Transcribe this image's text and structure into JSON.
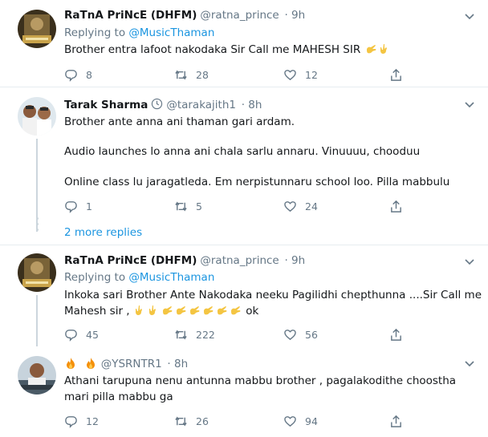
{
  "tweets": [
    {
      "name": "RaTnA PriNcE (DHFM)",
      "handle": "@ratna_prince",
      "time": "· 9h",
      "replying_prefix": "Replying to",
      "replying_to": "@MusicThaman",
      "lines": [
        "Brother entra lafoot nakodaka Sir Call me MAHESH SIR"
      ],
      "replies": "8",
      "retweets": "28",
      "likes": "12"
    },
    {
      "name": "Tarak Sharma",
      "handle": "@tarakajith1",
      "time": "· 8h",
      "lines": [
        "Brother ante anna ani thaman gari ardam.",
        "Audio launches lo anna ani chala sarlu annaru. Vinuuuu, chooduu",
        "Online class lu jaragatleda. Em nerpistunnaru school loo. Pilla mabbulu"
      ],
      "replies": "1",
      "retweets": "5",
      "likes": "24"
    },
    {
      "name": "RaTnA PriNcE (DHFM)",
      "handle": "@ratna_prince",
      "time": "· 9h",
      "replying_prefix": "Replying to",
      "replying_to": "@MusicThaman",
      "lines": [
        "Inkoka sari Brother Ante Nakodaka neeku Pagilidhi chepthunna ....Sir Call me",
        "Mahesh sir ,",
        "ok"
      ],
      "replies": "45",
      "retweets": "222",
      "likes": "56"
    },
    {
      "name": "",
      "handle": "@YSRNTR1",
      "time": "· 8h",
      "lines": [
        "Athani tarupuna nenu antunna  mabbu brother , pagalakodithe choostha",
        "mari pilla mabbu ga"
      ],
      "replies": "12",
      "retweets": "26",
      "likes": "94"
    }
  ],
  "more_replies": "2 more replies",
  "icons": [
    "reply-icon",
    "retweet-icon",
    "like-icon",
    "share-icon",
    "chevron-down-icon",
    "verified-icon",
    "raised-hand-emoji",
    "fire-emoji"
  ],
  "colors": {
    "link": "#1b95e0",
    "muted": "#657786",
    "separator": "#e6ecf0",
    "text": "#14171a"
  }
}
